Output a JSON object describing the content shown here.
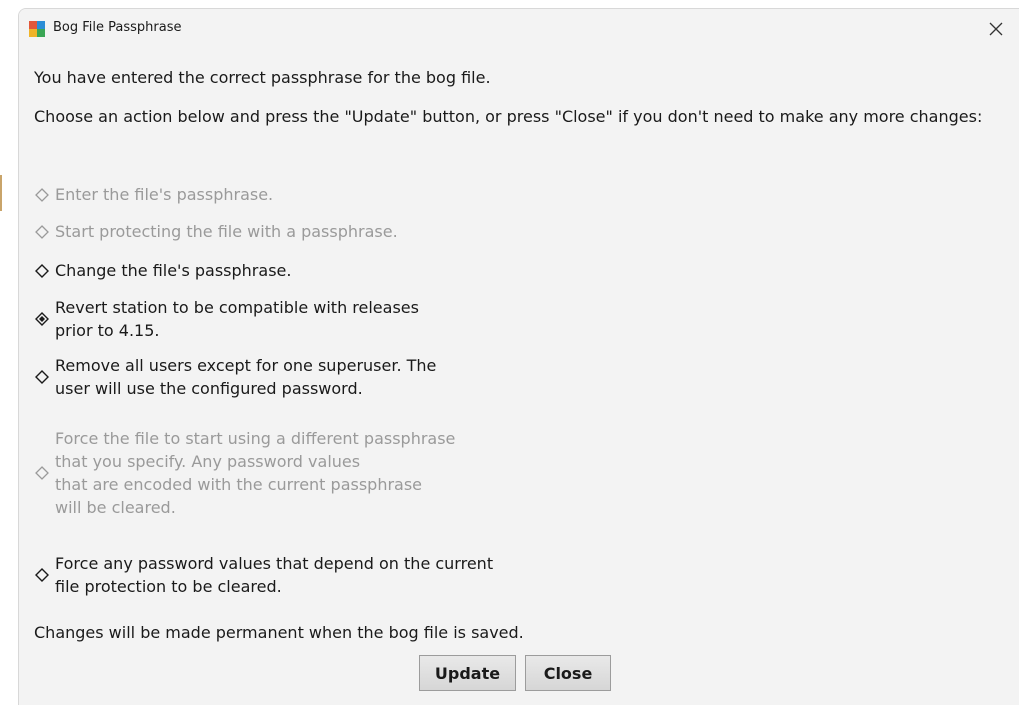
{
  "window": {
    "title": "Bog File Passphrase"
  },
  "content": {
    "line1": "You have entered the correct passphrase for the bog file.",
    "line2": "Choose an action below and press the \"Update\" button, or press \"Close\" if you don't need to make any more changes:",
    "footer": "Changes will be made permanent when the bog file is saved."
  },
  "options": [
    {
      "label": "Enter the file's passphrase.",
      "enabled": false,
      "selected": false
    },
    {
      "label": "Start protecting the file with a passphrase.",
      "enabled": false,
      "selected": false
    },
    {
      "label": "Change the file's passphrase.",
      "enabled": true,
      "selected": false
    },
    {
      "label": "Revert station to be compatible with releases\nprior to 4.15.",
      "enabled": true,
      "selected": true
    },
    {
      "label": "Remove all users except for one superuser. The\nuser will use the configured password.",
      "enabled": true,
      "selected": false
    },
    {
      "label": "Force the file to start using a different passphrase\nthat you specify. Any password values\nthat are encoded with the current passphrase\nwill be cleared.",
      "enabled": false,
      "selected": false
    },
    {
      "label": "Force any password values that depend on the current\nfile protection to be cleared.",
      "enabled": true,
      "selected": false
    }
  ],
  "buttons": {
    "update": "Update",
    "close": "Close"
  },
  "colors": {
    "enabled_text": "#1a1a1a",
    "disabled_text": "#9a9a9a",
    "dialog_bg": "#f3f3f3"
  },
  "icons": {
    "app": "niagara-app-icon",
    "close": "close-icon",
    "radio": "diamond-radio-icon"
  }
}
